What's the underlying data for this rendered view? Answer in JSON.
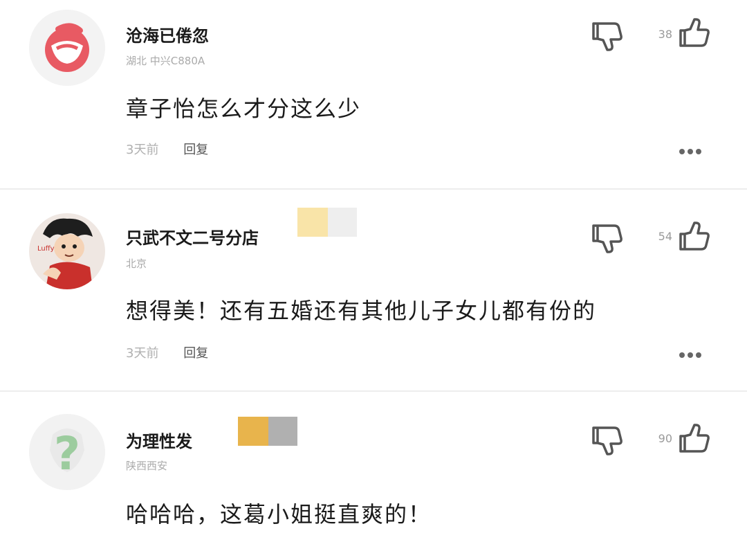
{
  "comments": [
    {
      "username": "沧海已倦忽",
      "meta": "湖北   中兴C880A",
      "text": "章子怡怎么才分这么少",
      "time": "3天前",
      "reply_label": "回复",
      "likes": "38",
      "avatar_icon": "red-logo-avatar",
      "badge_colors": []
    },
    {
      "username": "只武不文二号分店",
      "meta": "北京",
      "text": "想得美！还有五婚还有其他儿子女儿都有份的",
      "time": "3天前",
      "reply_label": "回复",
      "likes": "54",
      "avatar_icon": "anime-character-avatar",
      "badge_colors": [
        "#f9e4a8",
        "#eeeeee"
      ]
    },
    {
      "username": "为理性发",
      "meta": "陕西西安",
      "text": "哈哈哈，这葛小姐挺直爽的！",
      "time": "",
      "reply_label": "",
      "likes": "90",
      "avatar_icon": "question-mark-avatar",
      "badge_colors": [
        "#e8b44c",
        "#b0b0b0"
      ]
    }
  ],
  "colors": {
    "icon_stroke": "#555555",
    "divider": "#ededed"
  }
}
